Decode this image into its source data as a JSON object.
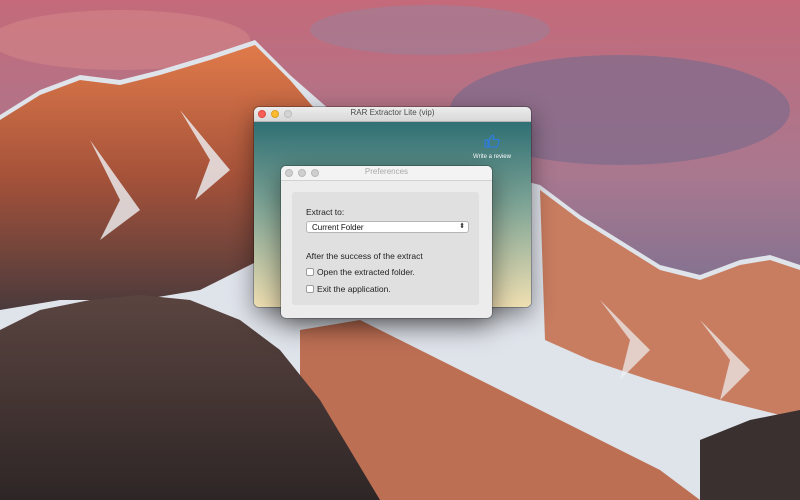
{
  "desktop": {
    "wallpaper": "mountain-sunset-wallpaper"
  },
  "main_window": {
    "title": "RAR Extractor Lite (vip)",
    "review_label": "Write a review",
    "review_icon": "thumbs-up-icon",
    "accent": "#4a90e2"
  },
  "prefs": {
    "title": "Preferences",
    "extract_to_label": "Extract to:",
    "extract_to_value": "Current Folder",
    "after_label": "After the success of the extract",
    "options": [
      {
        "label": "Open the extracted folder.",
        "checked": false
      },
      {
        "label": "Exit the application.",
        "checked": false
      }
    ]
  }
}
